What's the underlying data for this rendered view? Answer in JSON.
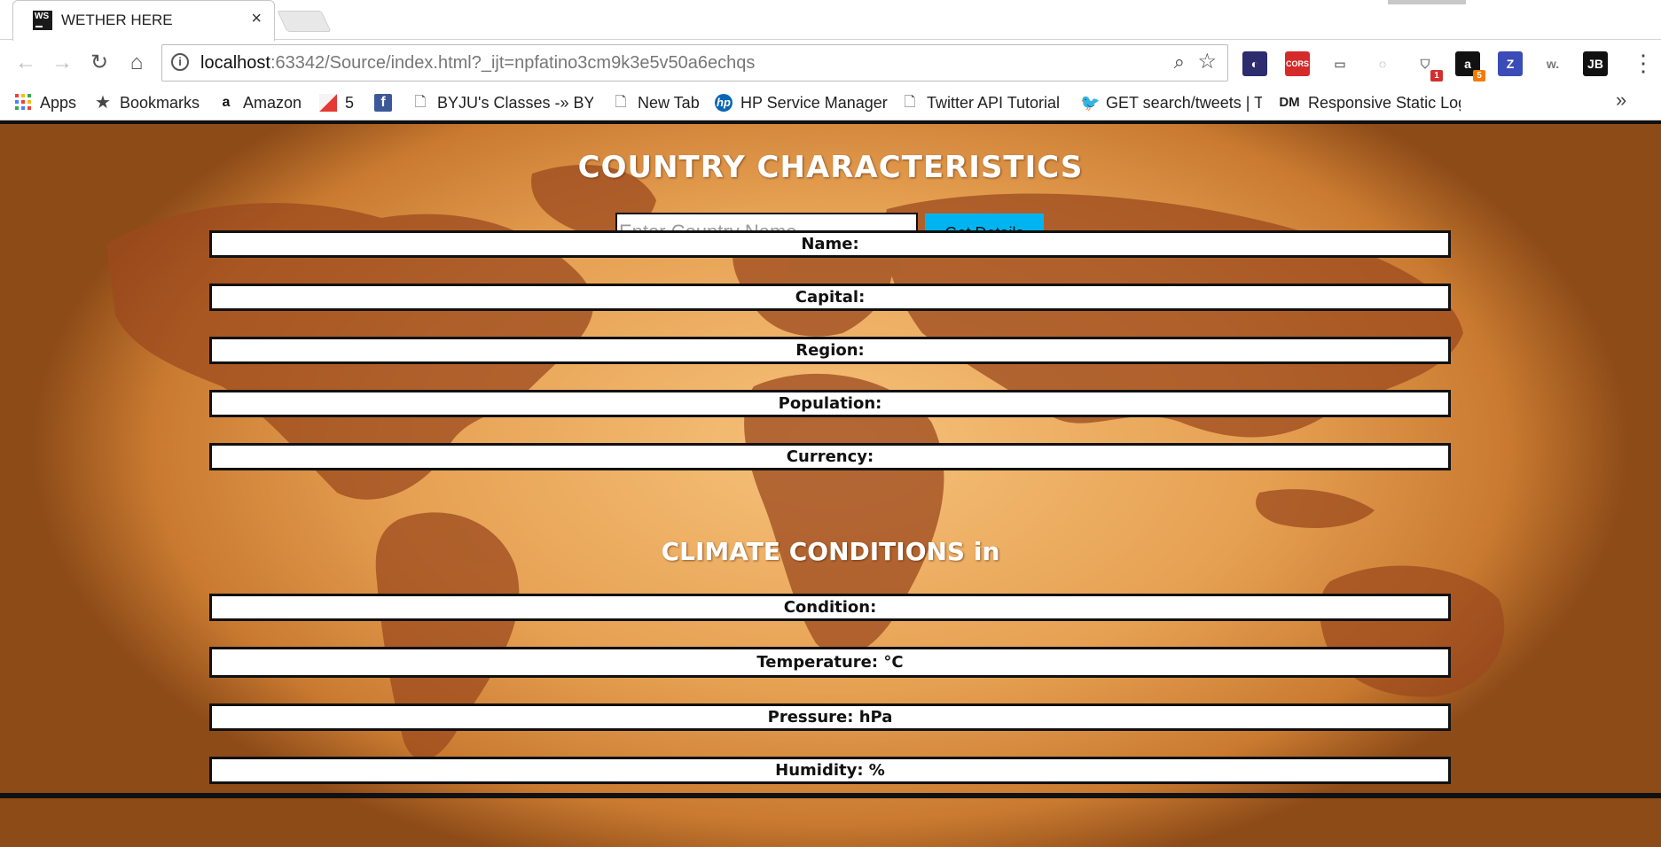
{
  "browser": {
    "tab": {
      "icon_text": "WS",
      "title": "WETHER HERE",
      "close": "×"
    },
    "nav": {
      "back": "←",
      "forward": "→",
      "reload": "↻",
      "home": "⌂"
    },
    "omnibox": {
      "info": "i",
      "host": "localhost",
      "rest": ":63342/Source/index.html?_ijt=npfatino3cm9k3e5v50a6echqs",
      "zoom_icon": "⌕",
      "star_icon": "☆"
    },
    "extensions": [
      {
        "name": "speedometer-extension-icon",
        "glyph": "◐",
        "color": "#2c2c6e",
        "badge": ""
      },
      {
        "name": "cors-extension-icon",
        "glyph": "CORS",
        "color": "#d42a2a",
        "badge": ""
      },
      {
        "name": "cast-extension-icon",
        "glyph": "▭",
        "color": "#ffffff",
        "badge": ""
      },
      {
        "name": "circle-extension-icon",
        "glyph": "◌",
        "color": "#ffffff",
        "badge": ""
      },
      {
        "name": "shield-extension-icon",
        "glyph": "⛉",
        "color": "#ffffff",
        "badge": "1"
      },
      {
        "name": "amazon-extension-icon",
        "glyph": "a",
        "color": "#111111",
        "badge": "5"
      },
      {
        "name": "z-extension-icon",
        "glyph": "Z",
        "color": "#3b4bb8",
        "badge": ""
      },
      {
        "name": "w-extension-icon",
        "glyph": "w.",
        "color": "#ffffff",
        "badge": ""
      },
      {
        "name": "jb-extension-icon",
        "glyph": "JB",
        "color": "#111111",
        "badge": ""
      }
    ],
    "menu": "⋮",
    "bookmarks": [
      {
        "label": "Apps",
        "icon": "apps-grid-icon"
      },
      {
        "label": "Bookmarks",
        "icon": "star-icon"
      },
      {
        "label": "Amazon",
        "icon": "amazon-icon"
      },
      {
        "label": "5",
        "icon": "red-flag-icon"
      },
      {
        "label": "",
        "icon": "facebook-icon"
      },
      {
        "label": "BYJU's Classes -» BYJU",
        "icon": "page-icon"
      },
      {
        "label": "New Tab",
        "icon": "page-icon"
      },
      {
        "label": "HP Service Manager",
        "icon": "hp-icon"
      },
      {
        "label": "Twitter API Tutorial",
        "icon": "page-icon"
      },
      {
        "label": "GET search/tweets | Tw",
        "icon": "twitter-icon"
      },
      {
        "label": "Responsive Static Log",
        "icon": "dm-icon"
      }
    ],
    "bookmarks_more": "»"
  },
  "page": {
    "title": "COUNTRY CHARACTERISTICS",
    "search": {
      "placeholder": "Enter Country Name",
      "value": "",
      "button": "Get Details"
    },
    "country_fields": [
      "Name:",
      "Capital:",
      "Region:",
      "Population:",
      "Currency:"
    ],
    "climate_title": "CLIMATE CONDITIONS in",
    "climate_fields": [
      "Condition:",
      "Temperature: °C",
      "Pressure: hPa",
      "Humidity: %"
    ],
    "colors": {
      "button": "#00b4f2",
      "map_land": "#9c4a1e",
      "background": "#e6a052"
    }
  }
}
